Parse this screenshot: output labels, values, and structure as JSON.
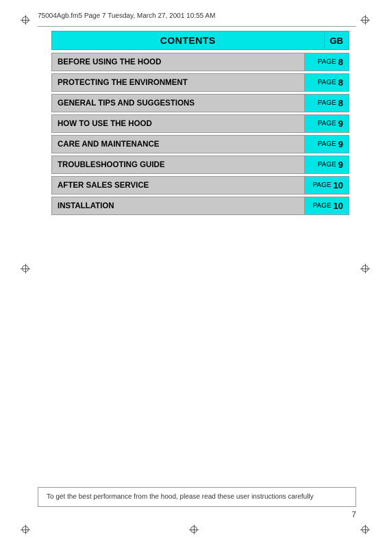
{
  "header": {
    "text": "75004Agb.fm5  Page 7  Tuesday, March 27, 2001  10:55 AM"
  },
  "contents": {
    "title": "CONTENTS",
    "gb_label": "GB"
  },
  "toc_items": [
    {
      "label": "BEFORE USING THE HOOD",
      "page_word": "PAGE",
      "page_num": "8"
    },
    {
      "label": "PROTECTING THE ENVIRONMENT",
      "page_word": "PAGE",
      "page_num": "8"
    },
    {
      "label": "GENERAL TIPS AND SUGGESTIONS",
      "page_word": "PAGE",
      "page_num": "8"
    },
    {
      "label": "HOW TO USE THE HOOD",
      "page_word": "PAGE",
      "page_num": "9"
    },
    {
      "label": "CARE AND MAINTENANCE",
      "page_word": "PAGE",
      "page_num": "9"
    },
    {
      "label": "TROUBLESHOOTING GUIDE",
      "page_word": "PAGE",
      "page_num": "9"
    },
    {
      "label": "AFTER SALES SERVICE",
      "page_word": "PAGE",
      "page_num": "10"
    },
    {
      "label": "INSTALLATION",
      "page_word": "PAGE",
      "page_num": "10"
    }
  ],
  "bottom_note": "To get the best performance from the hood, please read these user instructions carefully",
  "page_number": "7"
}
